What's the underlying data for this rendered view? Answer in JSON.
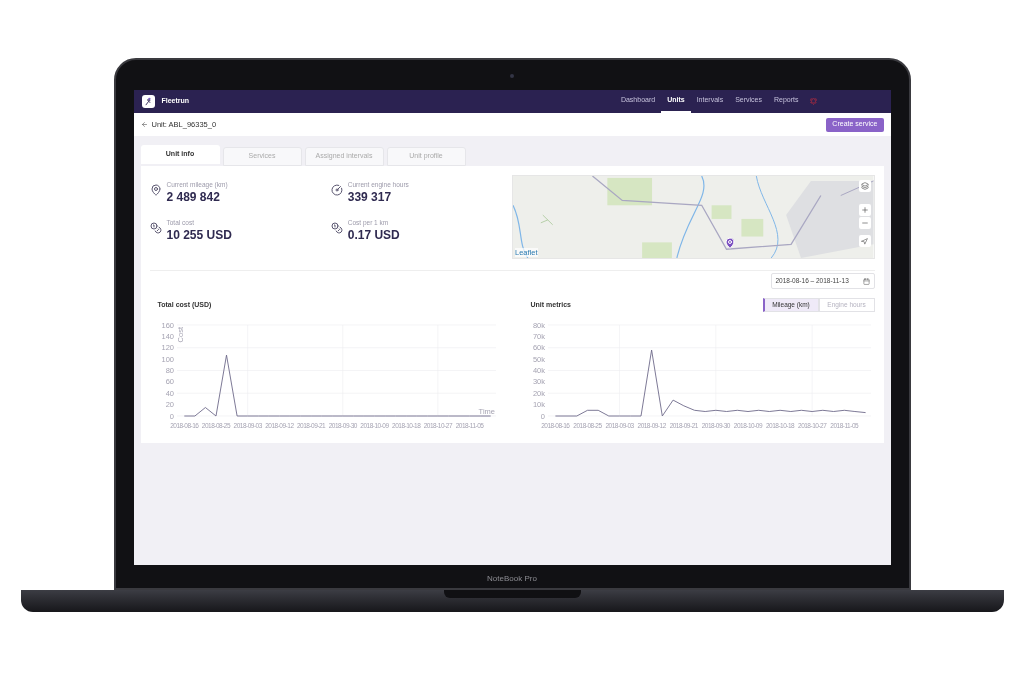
{
  "device": {
    "label": "NoteBook Pro"
  },
  "app": {
    "name": "Fleetrun"
  },
  "nav": [
    {
      "label": "Dashboard",
      "selected": false
    },
    {
      "label": "Units",
      "selected": true
    },
    {
      "label": "Intervals",
      "selected": false
    },
    {
      "label": "Services",
      "selected": false
    },
    {
      "label": "Reports",
      "selected": false
    }
  ],
  "header": {
    "title": "Unit: ABL_96335_0",
    "action": "Create service"
  },
  "tabs": [
    {
      "label": "Unit info",
      "selected": true
    },
    {
      "label": "Services",
      "selected": false
    },
    {
      "label": "Assigned intervals",
      "selected": false
    },
    {
      "label": "Unit profile",
      "selected": false
    }
  ],
  "stats": [
    {
      "kind": "mileage",
      "label": "Current mileage (km)",
      "value": "2 489 842"
    },
    {
      "kind": "hours",
      "label": "Current engine hours",
      "value": "339 317"
    },
    {
      "kind": "cost",
      "label": "Total cost",
      "value": "10 255 USD"
    },
    {
      "kind": "rate",
      "label": "Cost per 1 km",
      "value": "0.17 USD"
    }
  ],
  "map": {
    "attribution": "Leaflet"
  },
  "date_range": "2018-08-16 – 2018-11-13",
  "cost_chart": {
    "title": "Total cost (USD)",
    "chart_data": {
      "type": "line",
      "ylabel": "Cost",
      "xlabel": "Time",
      "categories": [
        "2018-08-16",
        null,
        null,
        "2018-08-25",
        null,
        null,
        "2018-09-03",
        null,
        null,
        "2018-09-12",
        null,
        null,
        "2018-09-21",
        null,
        null,
        "2018-09-30",
        null,
        null,
        "2018-10-09",
        null,
        null,
        "2018-10-18",
        null,
        null,
        "2018-10-27",
        null,
        null,
        "2018-11-05",
        null,
        null
      ],
      "series": [
        {
          "color": "#6e6a8a",
          "values": [
            0,
            0,
            15,
            0,
            107,
            0,
            0,
            0,
            0,
            0,
            0,
            0,
            0,
            0,
            0,
            0,
            0,
            0,
            0,
            0,
            0,
            0,
            0,
            0,
            0,
            0,
            0,
            0,
            0,
            0
          ]
        }
      ],
      "grid": true,
      "ylim": [
        0,
        160
      ],
      "yticks": [
        0,
        20,
        40,
        60,
        80,
        100,
        120,
        140,
        160
      ]
    }
  },
  "metrics_chart": {
    "title": "Unit metrics",
    "toggles": [
      {
        "label": "Mileage (km)",
        "selected": true
      },
      {
        "label": "Engine hours",
        "selected": false
      }
    ],
    "chart_data": {
      "type": "line",
      "categories": [
        "2018-08-16",
        null,
        null,
        "2018-08-25",
        null,
        null,
        "2018-09-03",
        null,
        null,
        "2018-09-12",
        null,
        null,
        "2018-09-21",
        null,
        null,
        "2018-09-30",
        null,
        null,
        "2018-10-09",
        null,
        null,
        "2018-10-18",
        null,
        null,
        "2018-10-27",
        null,
        null,
        "2018-11-05",
        null,
        null
      ],
      "series": [
        {
          "color": "#6e6a8a",
          "values": [
            0,
            0,
            0,
            5000,
            5000,
            0,
            0,
            0,
            0,
            58000,
            0,
            14000,
            9000,
            5000,
            4000,
            5000,
            4000,
            5000,
            4000,
            5000,
            4000,
            5000,
            4000,
            5000,
            4000,
            5000,
            4000,
            5000,
            4000,
            3000
          ]
        }
      ],
      "grid": true,
      "ylim": [
        0,
        80000
      ],
      "yticks": [
        {
          "value": 0,
          "label": "0"
        },
        {
          "value": 10000,
          "label": "10k"
        },
        {
          "value": 20000,
          "label": "20k"
        },
        {
          "value": 30000,
          "label": "30k"
        },
        {
          "value": 40000,
          "label": "40k"
        },
        {
          "value": 50000,
          "label": "50k"
        },
        {
          "value": 60000,
          "label": "60k"
        },
        {
          "value": 70000,
          "label": "70k"
        },
        {
          "value": 80000,
          "label": "80k"
        }
      ]
    }
  }
}
